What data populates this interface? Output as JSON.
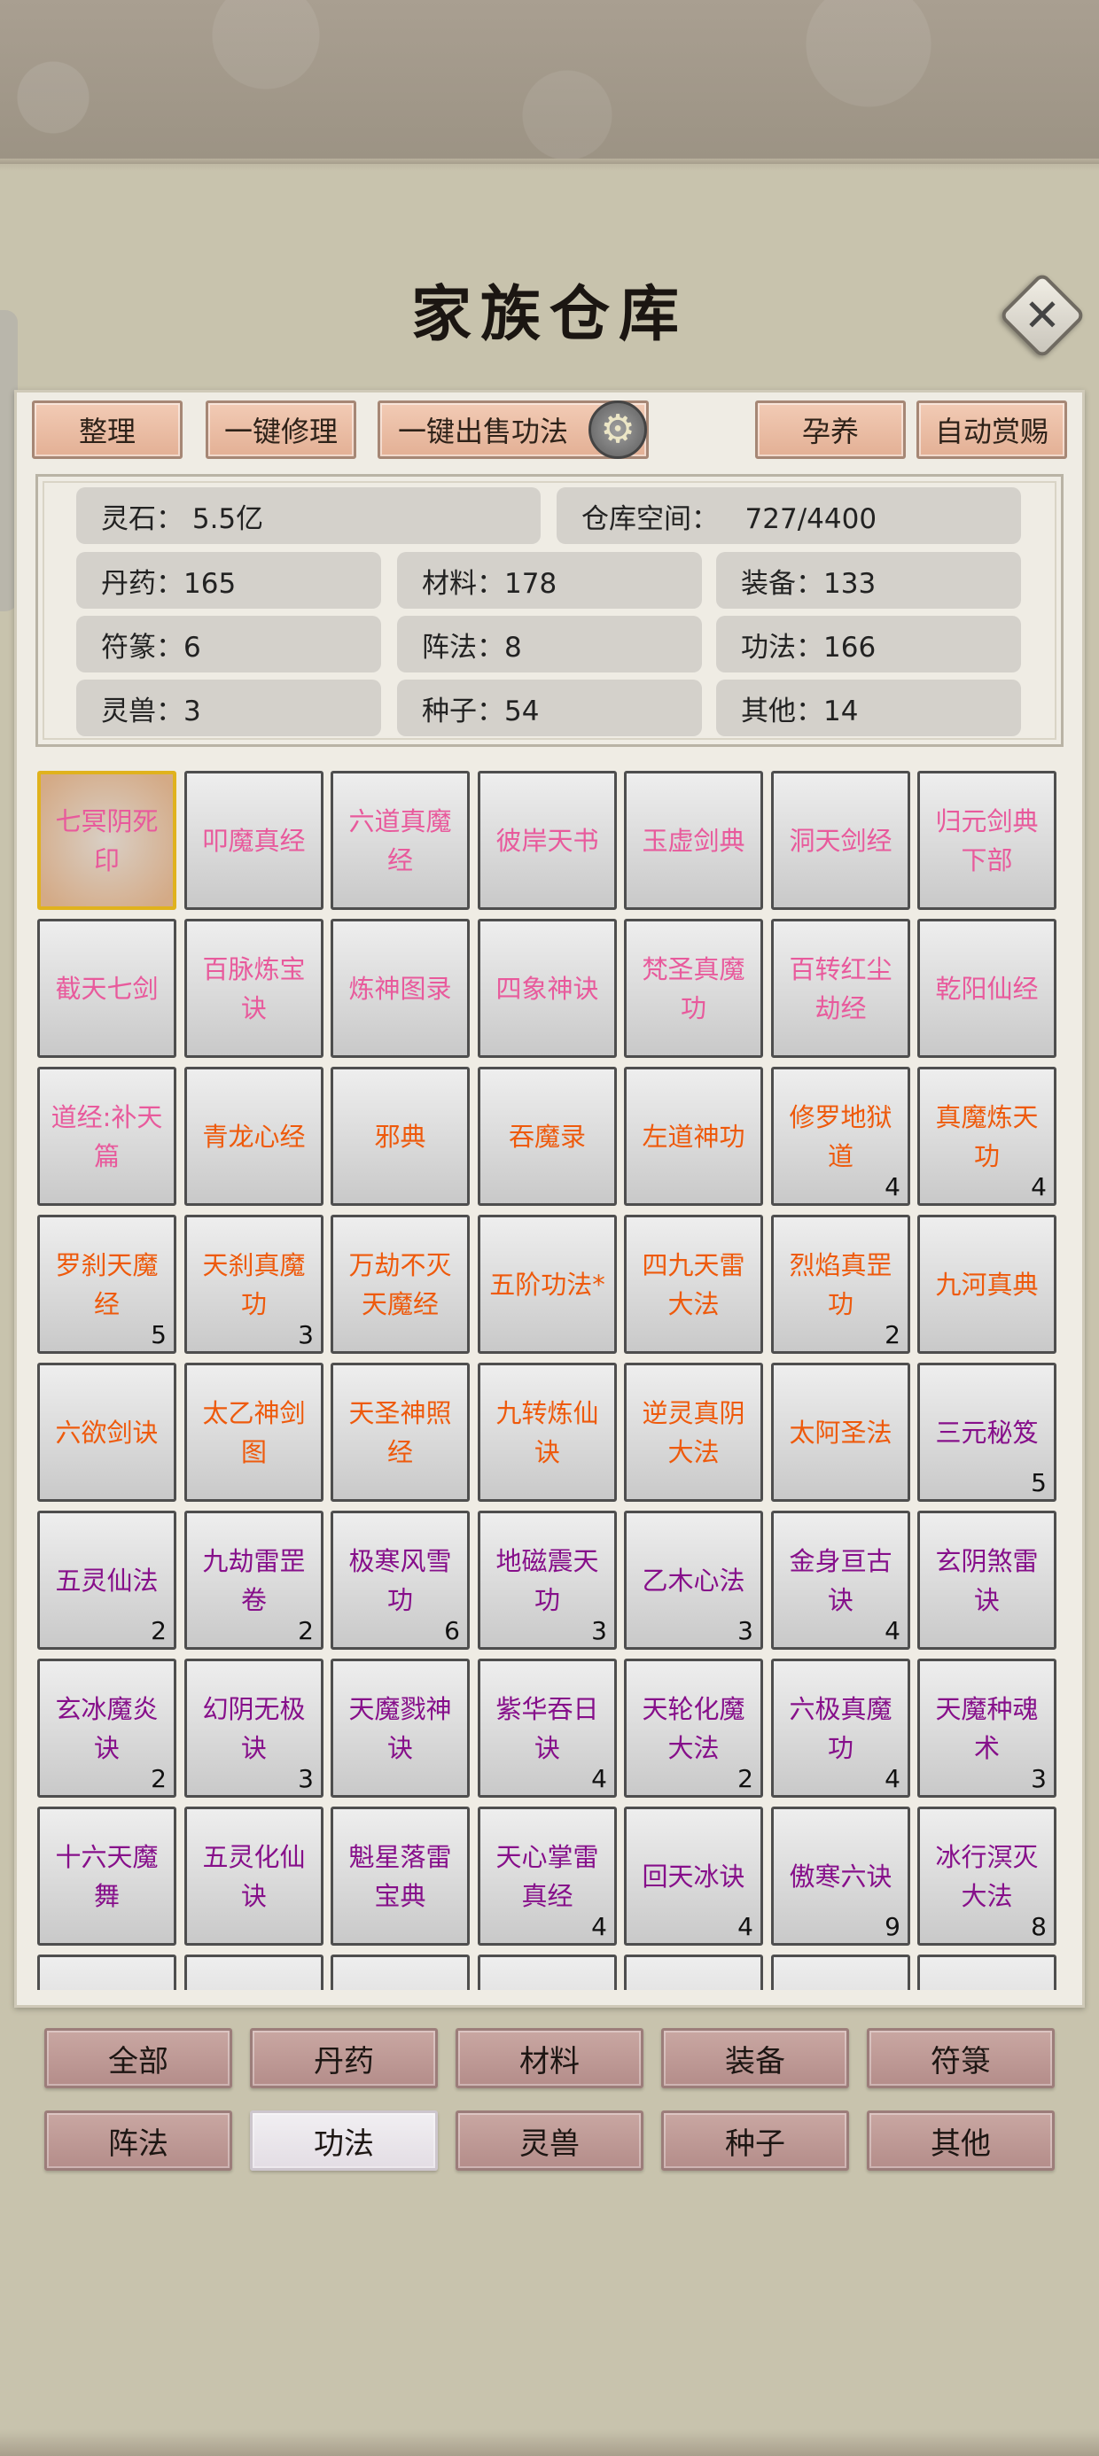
{
  "title": "家族仓库",
  "toolbar": {
    "sort": "整理",
    "repair_all": "一键修理",
    "sell_all_skills": "一键出售功法",
    "nurture": "孕养",
    "auto_reward": "自动赏赐"
  },
  "stats": {
    "spirit_stone": "灵石： 5.5亿",
    "storage_space": "仓库空间：   727/4400",
    "pills": "丹药：165",
    "materials": "材料：178",
    "equipment": "装备：133",
    "talismans": "符篆：6",
    "formations": "阵法：8",
    "skills": "功法：166",
    "beasts": "灵兽：3",
    "seeds": "种子：54",
    "others": "其他：14"
  },
  "colors": {
    "pink": "#e85a9c",
    "orange": "#ee5a0c",
    "purple": "#860f8a",
    "selected_border": "#e0b21d"
  },
  "items": [
    {
      "name": "七冥阴死印",
      "display": "七冥阴死\n印",
      "count": "",
      "tier": "pink",
      "selected": true
    },
    {
      "name": "叩魔真经",
      "display": "叩魔真经",
      "count": "",
      "tier": "pink"
    },
    {
      "name": "六道真魔经",
      "display": "六道真魔\n经",
      "count": "",
      "tier": "pink"
    },
    {
      "name": "彼岸天书",
      "display": "彼岸天书",
      "count": "",
      "tier": "pink"
    },
    {
      "name": "玉虚剑典",
      "display": "玉虚剑典",
      "count": "",
      "tier": "pink"
    },
    {
      "name": "洞天剑经",
      "display": "洞天剑经",
      "count": "",
      "tier": "pink"
    },
    {
      "name": "归元剑典下部",
      "display": "归元剑典\n下部",
      "count": "",
      "tier": "pink"
    },
    {
      "name": "截天七剑",
      "display": "截天七剑",
      "count": "",
      "tier": "pink"
    },
    {
      "name": "百脉炼宝诀",
      "display": "百脉炼宝\n诀",
      "count": "",
      "tier": "pink"
    },
    {
      "name": "炼神图录",
      "display": "炼神图录",
      "count": "",
      "tier": "pink"
    },
    {
      "name": "四象神诀",
      "display": "四象神诀",
      "count": "",
      "tier": "pink"
    },
    {
      "name": "梵圣真魔功",
      "display": "梵圣真魔\n功",
      "count": "",
      "tier": "pink"
    },
    {
      "name": "百转红尘劫经",
      "display": "百转红尘\n劫经",
      "count": "",
      "tier": "pink"
    },
    {
      "name": "乾阳仙经",
      "display": "乾阳仙经",
      "count": "",
      "tier": "pink"
    },
    {
      "name": "道经:补天篇",
      "display": "道经:补天\n篇",
      "count": "",
      "tier": "pink"
    },
    {
      "name": "青龙心经",
      "display": "青龙心经",
      "count": "",
      "tier": "orange"
    },
    {
      "name": "邪典",
      "display": "邪典",
      "count": "",
      "tier": "orange"
    },
    {
      "name": "吞魔录",
      "display": "吞魔录",
      "count": "",
      "tier": "orange"
    },
    {
      "name": "左道神功",
      "display": "左道神功",
      "count": "",
      "tier": "orange"
    },
    {
      "name": "修罗地狱道",
      "display": "修罗地狱\n道",
      "count": "4",
      "tier": "orange"
    },
    {
      "name": "真魔炼天功",
      "display": "真魔炼天\n功",
      "count": "4",
      "tier": "orange"
    },
    {
      "name": "罗刹天魔经",
      "display": "罗刹天魔\n经",
      "count": "5",
      "tier": "orange"
    },
    {
      "name": "天刹真魔功",
      "display": "天刹真魔\n功",
      "count": "3",
      "tier": "orange"
    },
    {
      "name": "万劫不灭天魔经",
      "display": "万劫不灭\n天魔经",
      "count": "",
      "tier": "orange"
    },
    {
      "name": "五阶功法*",
      "display": "五阶功法*",
      "count": "",
      "tier": "orange"
    },
    {
      "name": "四九天雷大法",
      "display": "四九天雷\n大法",
      "count": "",
      "tier": "orange"
    },
    {
      "name": "烈焰真罡功",
      "display": "烈焰真罡\n功",
      "count": "2",
      "tier": "orange"
    },
    {
      "name": "九河真典",
      "display": "九河真典",
      "count": "",
      "tier": "orange"
    },
    {
      "name": "六欲剑诀",
      "display": "六欲剑诀",
      "count": "",
      "tier": "orange"
    },
    {
      "name": "太乙神剑图",
      "display": "太乙神剑\n图",
      "count": "",
      "tier": "orange"
    },
    {
      "name": "天圣神照经",
      "display": "天圣神照\n经",
      "count": "",
      "tier": "orange"
    },
    {
      "name": "九转炼仙诀",
      "display": "九转炼仙\n诀",
      "count": "",
      "tier": "orange"
    },
    {
      "name": "逆灵真阴大法",
      "display": "逆灵真阴\n大法",
      "count": "",
      "tier": "orange"
    },
    {
      "name": "太阿圣法",
      "display": "太阿圣法",
      "count": "",
      "tier": "orange"
    },
    {
      "name": "三元秘笈",
      "display": "三元秘笈",
      "count": "5",
      "tier": "purple"
    },
    {
      "name": "五灵仙法",
      "display": "五灵仙法",
      "count": "2",
      "tier": "purple"
    },
    {
      "name": "九劫雷罡卷",
      "display": "九劫雷罡\n卷",
      "count": "2",
      "tier": "purple"
    },
    {
      "name": "极寒风雪功",
      "display": "极寒风雪\n功",
      "count": "6",
      "tier": "purple"
    },
    {
      "name": "地磁震天功",
      "display": "地磁震天\n功",
      "count": "3",
      "tier": "purple"
    },
    {
      "name": "乙木心法",
      "display": "乙木心法",
      "count": "3",
      "tier": "purple"
    },
    {
      "name": "金身亘古诀",
      "display": "金身亘古\n诀",
      "count": "4",
      "tier": "purple"
    },
    {
      "name": "玄阴煞雷诀",
      "display": "玄阴煞雷\n诀",
      "count": "",
      "tier": "purple"
    },
    {
      "name": "玄冰魔炎诀",
      "display": "玄冰魔炎\n诀",
      "count": "2",
      "tier": "purple"
    },
    {
      "name": "幻阴无极诀",
      "display": "幻阴无极\n诀",
      "count": "3",
      "tier": "purple"
    },
    {
      "name": "天魔戮神诀",
      "display": "天魔戮神\n诀",
      "count": "",
      "tier": "purple"
    },
    {
      "name": "紫华吞日诀",
      "display": "紫华吞日\n诀",
      "count": "4",
      "tier": "purple"
    },
    {
      "name": "天轮化魔大法",
      "display": "天轮化魔\n大法",
      "count": "2",
      "tier": "purple"
    },
    {
      "name": "六极真魔功",
      "display": "六极真魔\n功",
      "count": "4",
      "tier": "purple"
    },
    {
      "name": "天魔种魂术",
      "display": "天魔种魂\n术",
      "count": "3",
      "tier": "purple"
    },
    {
      "name": "十六天魔舞",
      "display": "十六天魔\n舞",
      "count": "",
      "tier": "purple"
    },
    {
      "name": "五灵化仙诀",
      "display": "五灵化仙\n诀",
      "count": "",
      "tier": "purple"
    },
    {
      "name": "魁星落雷宝典",
      "display": "魁星落雷\n宝典",
      "count": "",
      "tier": "purple"
    },
    {
      "name": "天心掌雷真经",
      "display": "天心掌雷\n真经",
      "count": "4",
      "tier": "purple"
    },
    {
      "name": "回天冰诀",
      "display": "回天冰诀",
      "count": "4",
      "tier": "purple"
    },
    {
      "name": "傲寒六诀",
      "display": "傲寒六诀",
      "count": "9",
      "tier": "purple"
    },
    {
      "name": "冰行溟灭大法",
      "display": "冰行溟灭\n大法",
      "count": "8",
      "tier": "purple"
    }
  ],
  "categories": [
    {
      "label": "全部"
    },
    {
      "label": "丹药"
    },
    {
      "label": "材料"
    },
    {
      "label": "装备"
    },
    {
      "label": "符箓"
    },
    {
      "label": "阵法"
    },
    {
      "label": "功法",
      "active": true
    },
    {
      "label": "灵兽"
    },
    {
      "label": "种子"
    },
    {
      "label": "其他"
    }
  ]
}
